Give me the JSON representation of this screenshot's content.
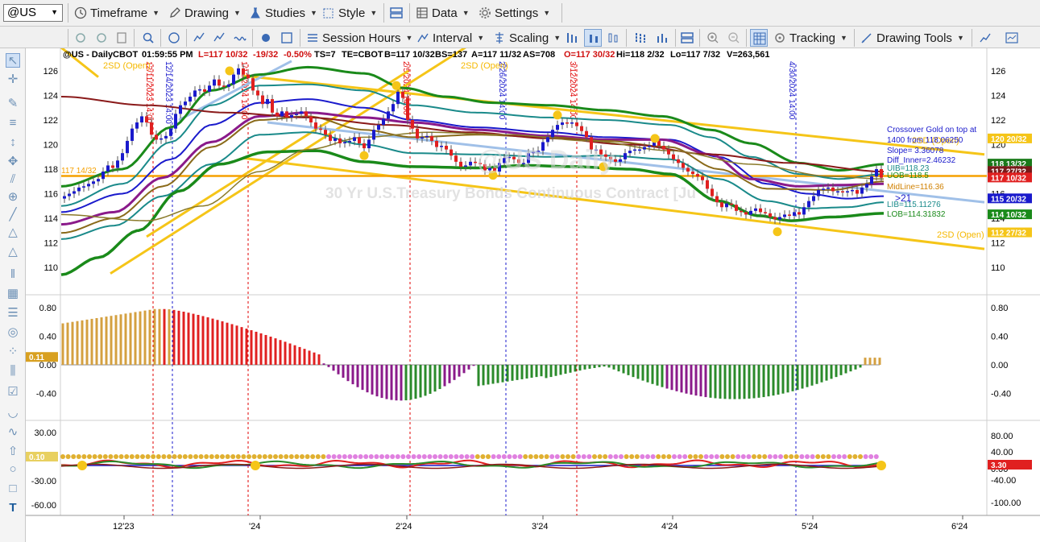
{
  "toolbar1": {
    "symbol": "@US",
    "items": [
      {
        "label": "Timeframe",
        "icon": "clock-icon"
      },
      {
        "label": "Drawing",
        "icon": "pencil-icon"
      },
      {
        "label": "Studies",
        "icon": "flask-icon"
      },
      {
        "label": "Style",
        "icon": "style-icon"
      },
      {
        "label": "Data",
        "icon": "data-icon"
      },
      {
        "label": "Settings",
        "icon": "gear-icon"
      }
    ]
  },
  "toolbar2": {
    "items": [
      {
        "label": "Session Hours",
        "icon": "session-icon"
      },
      {
        "label": "Interval",
        "icon": "interval-icon"
      },
      {
        "label": "Scaling",
        "icon": "scaling-icon"
      },
      {
        "label": "Tracking",
        "icon": "tracking-icon"
      },
      {
        "label": "Drawing Tools",
        "icon": "drawing-tools-icon"
      }
    ]
  },
  "header": {
    "symbol": "@US - Daily",
    "exchange": "CBOT",
    "time": "01:59:55 PM",
    "last": "L=117 10/32",
    "change": "-19/32",
    "pct": "-0.50%",
    "ts": "TS=7",
    "te": "TE=CBOT",
    "bid": "B=117 10/32",
    "bs": "BS=137",
    "ask": "A=117 11/32",
    "as": "AS=708",
    "open": "O=117 30/32",
    "hi": "Hi=118 2/32",
    "lo": "Lo=117 7/32",
    "vol": "V=263,561"
  },
  "watermark": {
    "symbol": "@US Daily",
    "description": "30 Yr U.S.Treasury Bonds Continuous Contract [Ju"
  },
  "price_axis": {
    "left": [
      "126",
      "124",
      "122",
      "120",
      "118",
      "116",
      "114",
      "112",
      "110"
    ],
    "right": [
      "126",
      "124",
      "122",
      "120",
      "118",
      "116",
      "114",
      "112",
      "110"
    ]
  },
  "price_tags": [
    {
      "text": "120 20/32",
      "bg": "#f5c518",
      "fg": "#ffffff"
    },
    {
      "text": "118 13/32",
      "bg": "#1a7a1a",
      "fg": "#ffffff"
    },
    {
      "text": "117 27/32",
      "bg": "#7a1a1a",
      "fg": "#ffffff"
    },
    {
      "text": "117 10/32",
      "bg": "#e02020",
      "fg": "#ffffff"
    },
    {
      "text": "115 20/32",
      "bg": "#1a1acc",
      "fg": "#ffffff"
    },
    {
      "text": "114 10/32",
      "bg": "#1a8a1a",
      "fg": "#ffffff"
    },
    {
      "text": "112 27/32",
      "bg": "#f5c518",
      "fg": "#ffffff"
    }
  ],
  "left_tag": "117 14/32",
  "annotations": {
    "sd_open_1": "2SD (Open)",
    "sd_open_2": "2SD (Open)",
    "sd_open_3": "2SD (Open)",
    "sd_open_4": "2SD (Open)",
    "crossover1": "Crossover Gold on top at",
    "crossover2": "1400 from 118.06250",
    "slope": "Slope= 3.36078",
    "diff_inner": "Diff_Inner=2.46232",
    "uib": "UIB=118.23",
    "uob": "UOB=118.5",
    "midline": "MidLine=116.36",
    "arrow21": ">21",
    "lib": "LIB=115.11276",
    "lob": "LOB=114.31832"
  },
  "date_labels": [
    "12/11/2023 14:00",
    "12/14/2023 14:00",
    "1/12/2024 14:00",
    "2/5/2024 14:00",
    "2/26/2024 14:00",
    "3/12/2024 14:00",
    "4/30/2024 14:00"
  ],
  "osc1": {
    "axis_left": [
      "0.80",
      "0.40",
      "0.00",
      "-0.40"
    ],
    "axis_right": [
      "0.80",
      "0.40",
      "0.00",
      "-0.40"
    ],
    "tag": "0.11"
  },
  "osc2": {
    "axis_left": [
      "30.00",
      "-30.00",
      "-60.00"
    ],
    "axis_right": [
      "80.00",
      "40.00",
      "0.00",
      "-40.00",
      "-100.00"
    ],
    "tag_left": "0.10",
    "tag_right": "3.30"
  },
  "time_axis": [
    "12'23",
    "'24",
    "2'24",
    "3'24",
    "4'24",
    "5'24",
    "6'24"
  ],
  "colors": {
    "green_band": "#1a8a1a",
    "teal_band": "#1a8a8a",
    "blue_band": "#1a1acc",
    "purple_ma": "#8a1a8a",
    "brown_ma": "#8a6a1a",
    "darkred_ma": "#8a1a1a",
    "light_blue": "#a0c0e8",
    "gold": "#f5c518",
    "orange_hline": "#f5a000"
  }
}
